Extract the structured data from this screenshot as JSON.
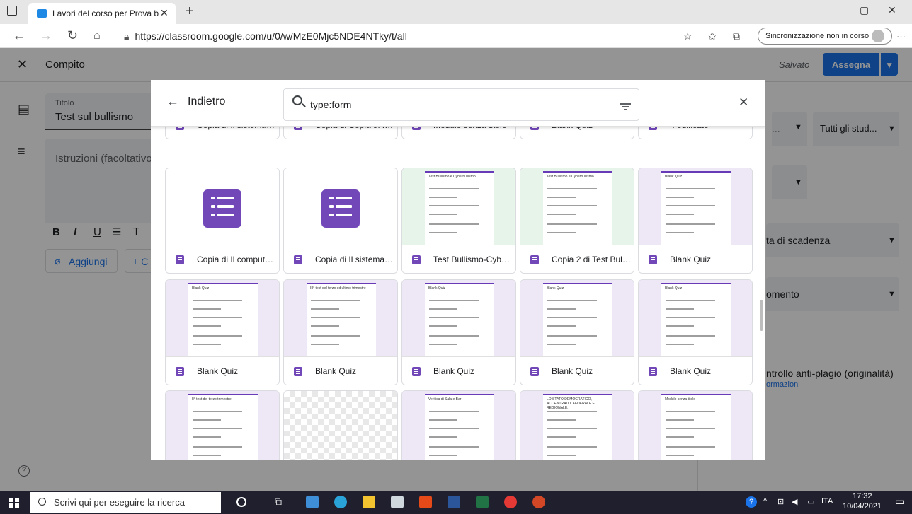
{
  "browser": {
    "tab_title": "Lavori del corso per Prova bullis",
    "tab_close": "✕",
    "new_tab": "+",
    "url": "https://classroom.google.com/u/0/w/MzE0Mjc5NDE4NTky/t/all",
    "sync_label": "Sincronizzazione non in corso",
    "menu": "···",
    "minimize": "—",
    "maximize": "▢",
    "close": "✕"
  },
  "classroom": {
    "close": "✕",
    "header_title": "Compito",
    "saved": "Salvato",
    "assign_button": "Assegna",
    "title_label": "Titolo",
    "title_value": "Test sul bullismo",
    "instructions_placeholder": "Istruzioni (facoltativo)",
    "add_button": "Aggiungi",
    "create_button": "+ C",
    "students_dropdown": "Tutti gli stud...",
    "due_date": "ta di scadenza",
    "topic": "omento",
    "plagiarism": "ntrollo anti-plagio (originalità)",
    "more_info": "ormazioni",
    "format_bold": "B",
    "format_italic": "I",
    "format_underline": "U",
    "format_list": "☰",
    "format_clear": "T̶"
  },
  "dialog": {
    "back_label": "Indietro",
    "search_value": "type:form",
    "close": "✕"
  },
  "files": [
    {
      "name": "Copia di Il sistema o...",
      "thumb": "partial"
    },
    {
      "name": "Copia di Copia di Il c...",
      "thumb": "partial"
    },
    {
      "name": "Modulo senza titolo",
      "thumb": "partial"
    },
    {
      "name": "Blank Quiz",
      "thumb": "partial"
    },
    {
      "name": "Modificato",
      "thumb": "partial"
    },
    {
      "name": "Copia di Il computer...",
      "thumb": "icon"
    },
    {
      "name": "Copia di Il sistema o...",
      "thumb": "icon"
    },
    {
      "name": "Test Bullismo-Cyber...",
      "thumb": "green",
      "preview_title": "Test Bullismo e Cyberbullismo"
    },
    {
      "name": "Copia 2 di Test Bulli...",
      "thumb": "green",
      "preview_title": "Test Bullismo e Cyberbullismo"
    },
    {
      "name": "Blank Quiz",
      "thumb": "purple",
      "preview_title": "Blank Quiz"
    },
    {
      "name": "Blank Quiz",
      "thumb": "purple",
      "preview_title": "Blank Quiz"
    },
    {
      "name": "Blank Quiz",
      "thumb": "purple",
      "preview_title": "III° test del terzo ed ultimo trimestre"
    },
    {
      "name": "Blank Quiz",
      "thumb": "purple",
      "preview_title": "Blank Quiz"
    },
    {
      "name": "Blank Quiz",
      "thumb": "purple",
      "preview_title": "Blank Quiz"
    },
    {
      "name": "Blank Quiz",
      "thumb": "purple",
      "preview_title": "Blank Quiz"
    },
    {
      "name": "",
      "thumb": "purple",
      "preview_title": "II° test del terzo trimestre"
    },
    {
      "name": "",
      "thumb": "checker"
    },
    {
      "name": "",
      "thumb": "purple",
      "preview_title": "Verifica di Sala e Bar"
    },
    {
      "name": "",
      "thumb": "purple",
      "preview_title": "LO STATO DEMOCRATICO, ACCENTRATO, FEDERALE E REGIONALE."
    },
    {
      "name": "",
      "thumb": "purple",
      "preview_title": "Modulo senza titolo"
    }
  ],
  "taskbar": {
    "search_placeholder": "Scrivi qui per eseguire la ricerca",
    "language": "ITA",
    "time": "17:32",
    "date": "10/04/2021"
  },
  "colors": {
    "accent": "#1a73e8",
    "forms_purple": "#7248b9"
  }
}
